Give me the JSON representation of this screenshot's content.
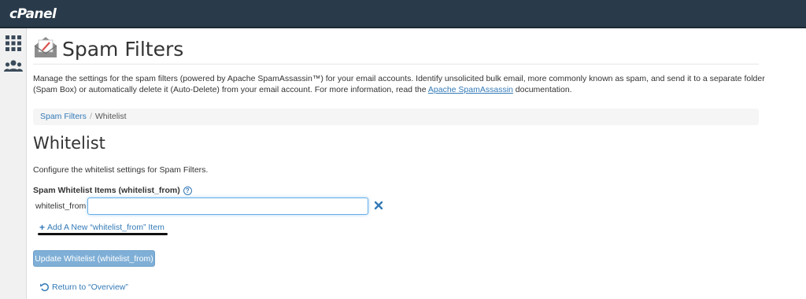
{
  "topbar": {
    "logo": "cPanel"
  },
  "sidebar": {
    "items": [
      {
        "icon": "grid-icon"
      },
      {
        "icon": "users-icon"
      }
    ]
  },
  "page": {
    "title": "Spam Filters",
    "description_before": "Manage the settings for the spam filters (powered by Apache SpamAssassin™) for your email accounts. Identify unsolicited bulk email, more commonly known as spam, and send it to a separate folder (Spam Box) or automatically delete it (Auto-Delete) from your email account. For more information, read the ",
    "description_link": "Apache SpamAssassin",
    "description_after": " documentation."
  },
  "breadcrumb": {
    "parent": "Spam Filters",
    "separator": "/",
    "current": "Whitelist"
  },
  "section": {
    "title": "Whitelist",
    "description": "Configure the whitelist settings for Spam Filters."
  },
  "form": {
    "field_label": "Spam Whitelist Items (whitelist_from)",
    "help_glyph": "?",
    "row_label": "whitelist_from",
    "input_value": "",
    "remove_glyph": "✕",
    "add_plus": "+",
    "add_link": "Add A New “whitelist_from” Item",
    "submit_label": "Update Whitelist (whitelist_from)",
    "return_link": "Return to “Overview”"
  },
  "colors": {
    "topbar": "#293a4a",
    "link": "#337ab7",
    "button": "#7fafd6"
  }
}
